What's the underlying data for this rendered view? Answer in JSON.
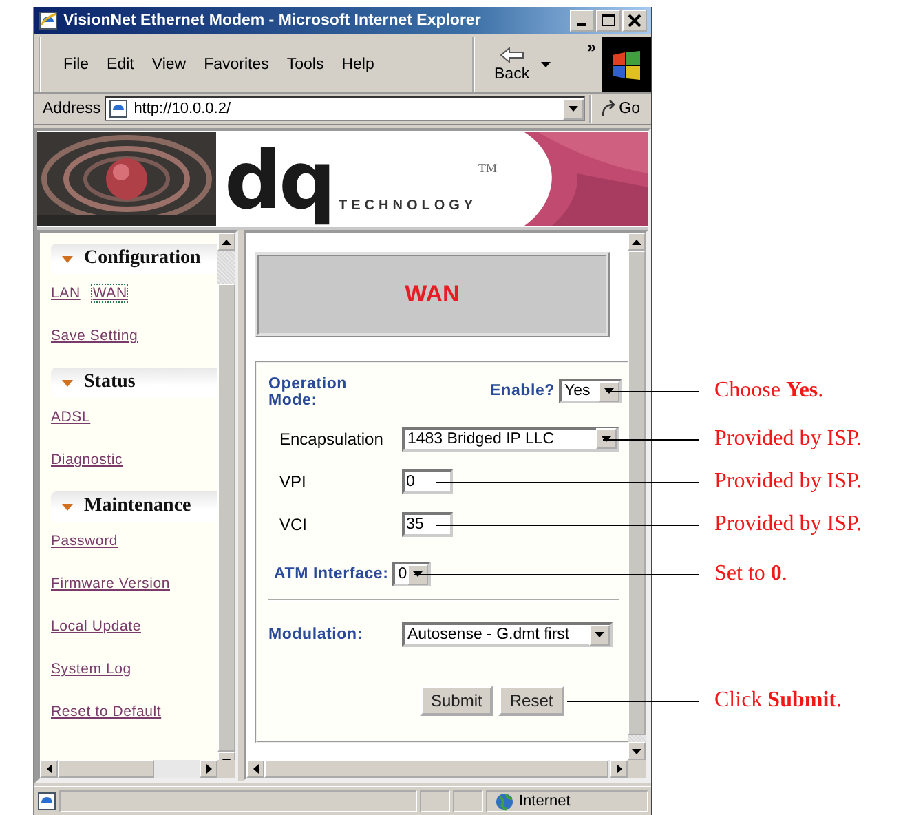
{
  "window": {
    "title": "VisionNet Ethernet Modem - Microsoft Internet Explorer"
  },
  "menu": [
    "File",
    "Edit",
    "View",
    "Favorites",
    "Tools",
    "Help"
  ],
  "toolbar": {
    "back": "Back",
    "more": "»"
  },
  "address_bar": {
    "label": "Address",
    "url": "http://10.0.0.2/",
    "go": "Go"
  },
  "banner": {
    "logo": "dq",
    "tagline": "TECHNOLOGY",
    "trademark": "TM"
  },
  "sidebar": {
    "sections": [
      {
        "title": "Configuration",
        "rows": [
          [
            {
              "label": "LAN",
              "selected": false
            },
            {
              "label": "WAN",
              "selected": true
            }
          ],
          [
            {
              "label": "Save Setting",
              "selected": false
            }
          ]
        ]
      },
      {
        "title": "Status",
        "rows": [
          [
            {
              "label": "ADSL",
              "selected": false
            }
          ],
          [
            {
              "label": "Diagnostic",
              "selected": false
            }
          ]
        ]
      },
      {
        "title": "Maintenance",
        "rows": [
          [
            {
              "label": "Password",
              "selected": false
            }
          ],
          [
            {
              "label": "Firmware Version",
              "selected": false
            }
          ],
          [
            {
              "label": "Local Update",
              "selected": false
            }
          ],
          [
            {
              "label": "System Log",
              "selected": false
            }
          ],
          [
            {
              "label": "Reset to Default",
              "selected": false
            }
          ]
        ]
      }
    ]
  },
  "page": {
    "heading": "WAN",
    "operation_mode": {
      "label": "Operation Mode:",
      "enable_label": "Enable?",
      "value": "Yes",
      "callout": "Choose **Yes**."
    },
    "fields": [
      {
        "kind": "select",
        "label": "Encapsulation",
        "value": "1483 Bridged IP LLC",
        "callout": "Provided by ISP."
      },
      {
        "kind": "text",
        "label": "VPI",
        "value": "0",
        "callout": "Provided by ISP."
      },
      {
        "kind": "text",
        "label": "VCI",
        "value": "35",
        "callout": "Provided by ISP."
      }
    ],
    "atm_interface": {
      "label": "ATM Interface:",
      "value": "0",
      "callout": "Set to **0**."
    },
    "modulation": {
      "label": "Modulation:",
      "value": "Autosense - G.dmt first"
    },
    "buttons": [
      {
        "label": "Submit",
        "callout": "Click **Submit**."
      },
      {
        "label": "Reset"
      }
    ]
  },
  "status_bar": {
    "zone": "Internet"
  }
}
